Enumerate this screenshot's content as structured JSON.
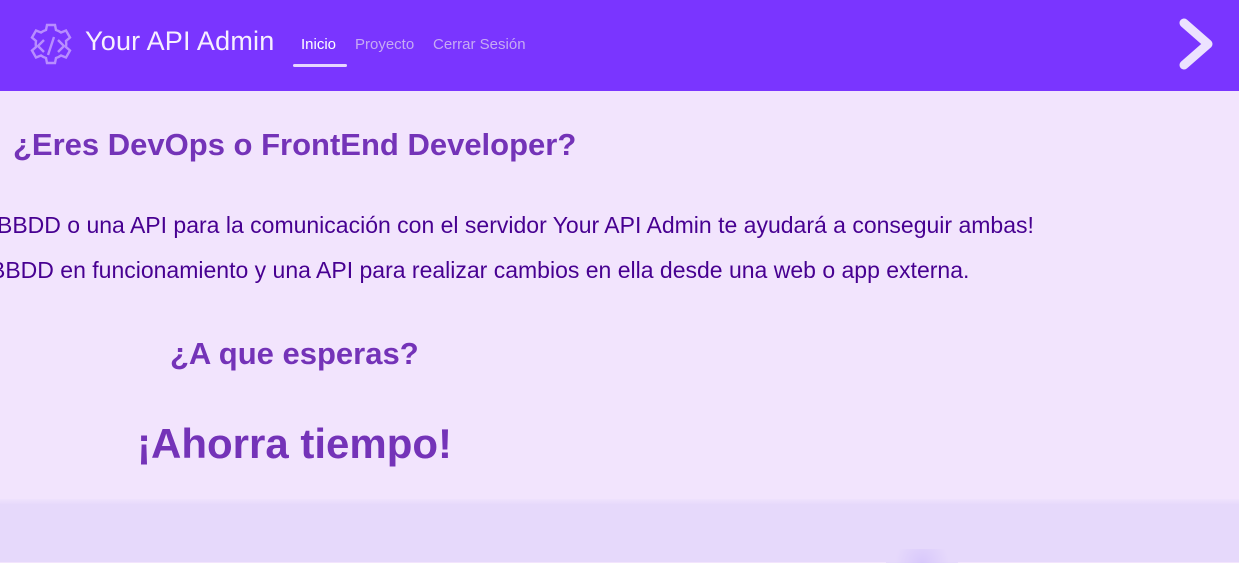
{
  "header": {
    "brand_icon": "code-gear-icon",
    "brand_title": "Your API Admin",
    "nav": [
      {
        "label": "Inicio",
        "active": true
      },
      {
        "label": "Proyecto",
        "active": false
      },
      {
        "label": "Cerrar Sesión",
        "active": false
      }
    ],
    "next_icon": "chevron-right-icon",
    "colors": {
      "bar": "#7a35ff",
      "title": "#f6efff",
      "nav_inactive": "#c6aaf4"
    }
  },
  "main": {
    "heading": "¿Eres DevOps o FrontEnd Developer?",
    "paragraph_line_1": "BBDD o una API para la comunicación con el servidor Your API Admin te ayudará a conseguir ambas!",
    "paragraph_line_2": "BBDD en funcionamiento y una API para realizar cambios en ella desde una web o app externa.",
    "subheading": "¿A que esperas?",
    "cta_heading": "¡Ahorra tiempo!",
    "colors": {
      "background": "#f2e4fd",
      "heading": "#7433b8",
      "text": "#470091"
    }
  }
}
